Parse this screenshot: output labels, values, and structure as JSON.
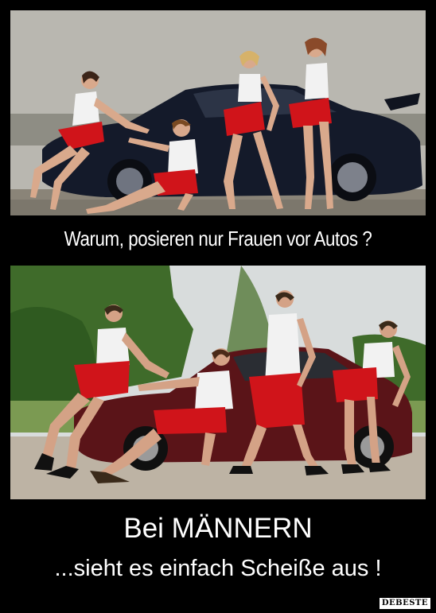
{
  "captions": {
    "top": "Warum, posieren nur Frauen vor Autos ?",
    "bottom_line1": "Bei MÄNNERN",
    "bottom_line2": "...sieht es einfach Scheiße aus !"
  },
  "watermark": "DEBESTE",
  "colors": {
    "background": "#000000",
    "caption_text": "#ffffff",
    "top_car": "#141a2a",
    "bottom_car": "#5a1418",
    "red_clothing": "#d0141a",
    "white_shirt": "#f2f2f2"
  }
}
